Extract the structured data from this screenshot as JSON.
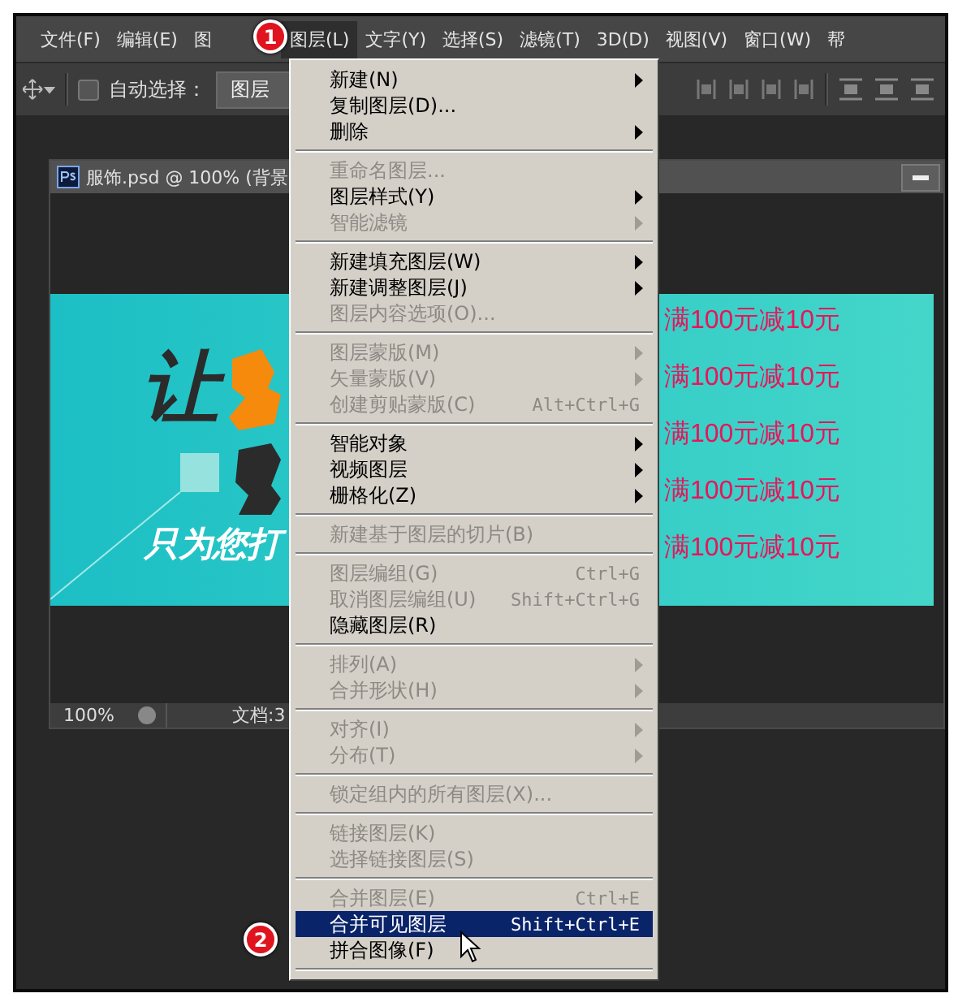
{
  "menubar": [
    {
      "label": "文件(F)",
      "selected": false
    },
    {
      "label": "编辑(E)",
      "selected": false
    },
    {
      "label": "图",
      "selected": false
    },
    {
      "label": "图层(L)",
      "selected": true
    },
    {
      "label": "文字(Y)",
      "selected": false
    },
    {
      "label": "选择(S)",
      "selected": false
    },
    {
      "label": "滤镜(T)",
      "selected": false
    },
    {
      "label": "3D(D)",
      "selected": false
    },
    {
      "label": "视图(V)",
      "selected": false
    },
    {
      "label": "窗口(W)",
      "selected": false
    },
    {
      "label": "帮",
      "selected": false
    }
  ],
  "options_bar": {
    "auto_select": {
      "label": "自动选择：",
      "checked": false
    },
    "target": "图层"
  },
  "document": {
    "title": "服饰.psd @ 100% (背景",
    "zoom": "100%",
    "doc_info": "文档:3",
    "canvas": {
      "headline_1": "让",
      "subtitle": "只为您打",
      "promos": [
        "满100元减10元",
        "满100元减10元",
        "满100元减10元",
        "满100元减10元",
        "满100元减10元"
      ]
    }
  },
  "badges": [
    "1",
    "2"
  ],
  "layer_menu": [
    {
      "kind": "item",
      "label": "新建(N)",
      "disabled": false,
      "submenu": true,
      "selected": false
    },
    {
      "kind": "item",
      "label": "复制图层(D)...",
      "disabled": false,
      "submenu": false,
      "selected": false
    },
    {
      "kind": "item",
      "label": "删除",
      "disabled": false,
      "submenu": true,
      "selected": false
    },
    {
      "kind": "separator"
    },
    {
      "kind": "item",
      "label": "重命名图层...",
      "disabled": true,
      "submenu": false,
      "selected": false
    },
    {
      "kind": "item",
      "label": "图层样式(Y)",
      "disabled": false,
      "submenu": true,
      "selected": false
    },
    {
      "kind": "item",
      "label": "智能滤镜",
      "disabled": true,
      "submenu": true,
      "selected": false
    },
    {
      "kind": "separator"
    },
    {
      "kind": "item",
      "label": "新建填充图层(W)",
      "disabled": false,
      "submenu": true,
      "selected": false
    },
    {
      "kind": "item",
      "label": "新建调整图层(J)",
      "disabled": false,
      "submenu": true,
      "selected": false
    },
    {
      "kind": "item",
      "label": "图层内容选项(O)...",
      "disabled": true,
      "submenu": false,
      "selected": false
    },
    {
      "kind": "separator"
    },
    {
      "kind": "item",
      "label": "图层蒙版(M)",
      "disabled": true,
      "submenu": true,
      "selected": false
    },
    {
      "kind": "item",
      "label": "矢量蒙版(V)",
      "disabled": true,
      "submenu": true,
      "selected": false
    },
    {
      "kind": "item",
      "label": "创建剪贴蒙版(C)",
      "shortcut": "Alt+Ctrl+G",
      "disabled": true,
      "submenu": false,
      "selected": false
    },
    {
      "kind": "separator"
    },
    {
      "kind": "item",
      "label": "智能对象",
      "disabled": false,
      "submenu": true,
      "selected": false
    },
    {
      "kind": "item",
      "label": "视频图层",
      "disabled": false,
      "submenu": true,
      "selected": false
    },
    {
      "kind": "item",
      "label": "栅格化(Z)",
      "disabled": false,
      "submenu": true,
      "selected": false
    },
    {
      "kind": "separator"
    },
    {
      "kind": "item",
      "label": "新建基于图层的切片(B)",
      "disabled": true,
      "submenu": false,
      "selected": false
    },
    {
      "kind": "separator"
    },
    {
      "kind": "item",
      "label": "图层编组(G)",
      "shortcut": "Ctrl+G",
      "disabled": true,
      "submenu": false,
      "selected": false
    },
    {
      "kind": "item",
      "label": "取消图层编组(U)",
      "shortcut": "Shift+Ctrl+G",
      "disabled": true,
      "submenu": false,
      "selected": false
    },
    {
      "kind": "item",
      "label": "隐藏图层(R)",
      "disabled": false,
      "submenu": false,
      "selected": false
    },
    {
      "kind": "separator"
    },
    {
      "kind": "item",
      "label": "排列(A)",
      "disabled": true,
      "submenu": true,
      "selected": false
    },
    {
      "kind": "item",
      "label": "合并形状(H)",
      "disabled": true,
      "submenu": true,
      "selected": false
    },
    {
      "kind": "separator"
    },
    {
      "kind": "item",
      "label": "对齐(I)",
      "disabled": true,
      "submenu": true,
      "selected": false
    },
    {
      "kind": "item",
      "label": "分布(T)",
      "disabled": true,
      "submenu": true,
      "selected": false
    },
    {
      "kind": "separator"
    },
    {
      "kind": "item",
      "label": "锁定组内的所有图层(X)...",
      "disabled": true,
      "submenu": false,
      "selected": false
    },
    {
      "kind": "separator"
    },
    {
      "kind": "item",
      "label": "链接图层(K)",
      "disabled": true,
      "submenu": false,
      "selected": false
    },
    {
      "kind": "item",
      "label": "选择链接图层(S)",
      "disabled": true,
      "submenu": false,
      "selected": false
    },
    {
      "kind": "separator"
    },
    {
      "kind": "item",
      "label": "合并图层(E)",
      "shortcut": "Ctrl+E",
      "disabled": true,
      "submenu": false,
      "selected": false
    },
    {
      "kind": "item",
      "label": "合并可见图层",
      "shortcut": "Shift+Ctrl+E",
      "disabled": false,
      "submenu": false,
      "selected": true
    },
    {
      "kind": "item",
      "label": "拼合图像(F)",
      "disabled": false,
      "submenu": false,
      "selected": false
    },
    {
      "kind": "separator"
    }
  ]
}
